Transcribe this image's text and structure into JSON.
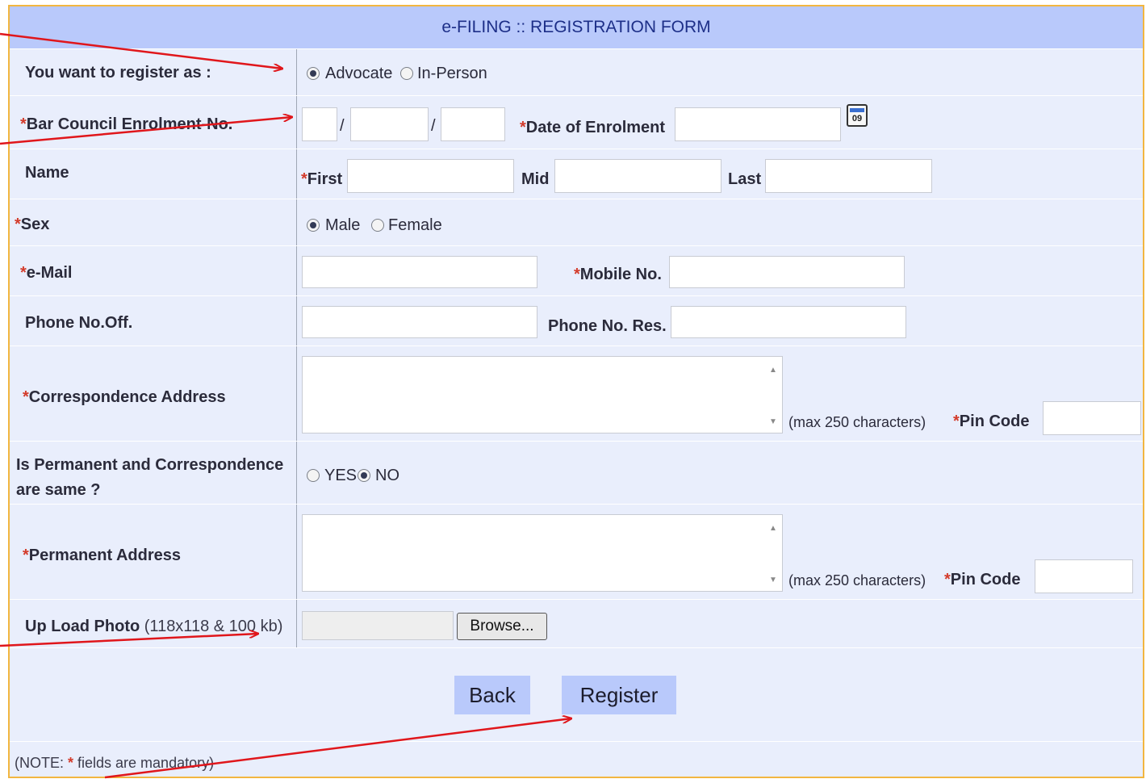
{
  "form": {
    "title": "e-FILING :: REGISTRATION FORM",
    "register_as": {
      "label": "You want to register as :",
      "options": [
        "Advocate",
        "In-Person"
      ],
      "selected": "Advocate"
    },
    "bar_council": {
      "star": "*",
      "label": "Bar Council Enrolment-No.",
      "separator": "/"
    },
    "date_of_enrolment": {
      "star": "*",
      "label": "Date of Enrolment",
      "calendar_text": "09"
    },
    "name": {
      "label": "Name",
      "first_star": "*",
      "first": "First",
      "mid": "Mid",
      "last": "Last"
    },
    "sex": {
      "star": "*",
      "label": "Sex",
      "options": [
        "Male",
        "Female"
      ],
      "selected": "Male"
    },
    "email": {
      "star": "*",
      "label": "e-Mail"
    },
    "mobile": {
      "star": "*",
      "label": "Mobile No."
    },
    "phone_off": {
      "label": "Phone No.Off."
    },
    "phone_res": {
      "label": "Phone No. Res."
    },
    "correspondence": {
      "star": "*",
      "label": "Correspondence Address",
      "hint": "(max 250 characters)",
      "pin_star": "*",
      "pin_label": "Pin Code"
    },
    "same": {
      "label": "Is Permanent and Correspondence are same ?",
      "options": [
        "YES",
        "NO"
      ],
      "selected": "NO"
    },
    "permanent": {
      "star": "*",
      "label": "Permanent Address",
      "hint": "(max 250 characters)",
      "pin_star": "*",
      "pin_label": "Pin Code"
    },
    "photo": {
      "label": "Up Load Photo",
      "hint": "(118x118 & 100 kb)",
      "browse": "Browse..."
    },
    "buttons": {
      "back": "Back",
      "register": "Register"
    },
    "note": {
      "prefix": "(NOTE: ",
      "star": "*",
      "suffix": " fields are mandatory)"
    }
  },
  "colors": {
    "title_bg": "#b9c9fb",
    "form_bg": "#e9eefc",
    "border": "#f2b640",
    "required": "#d33b2b",
    "annotation_arrow": "#e0161b"
  }
}
